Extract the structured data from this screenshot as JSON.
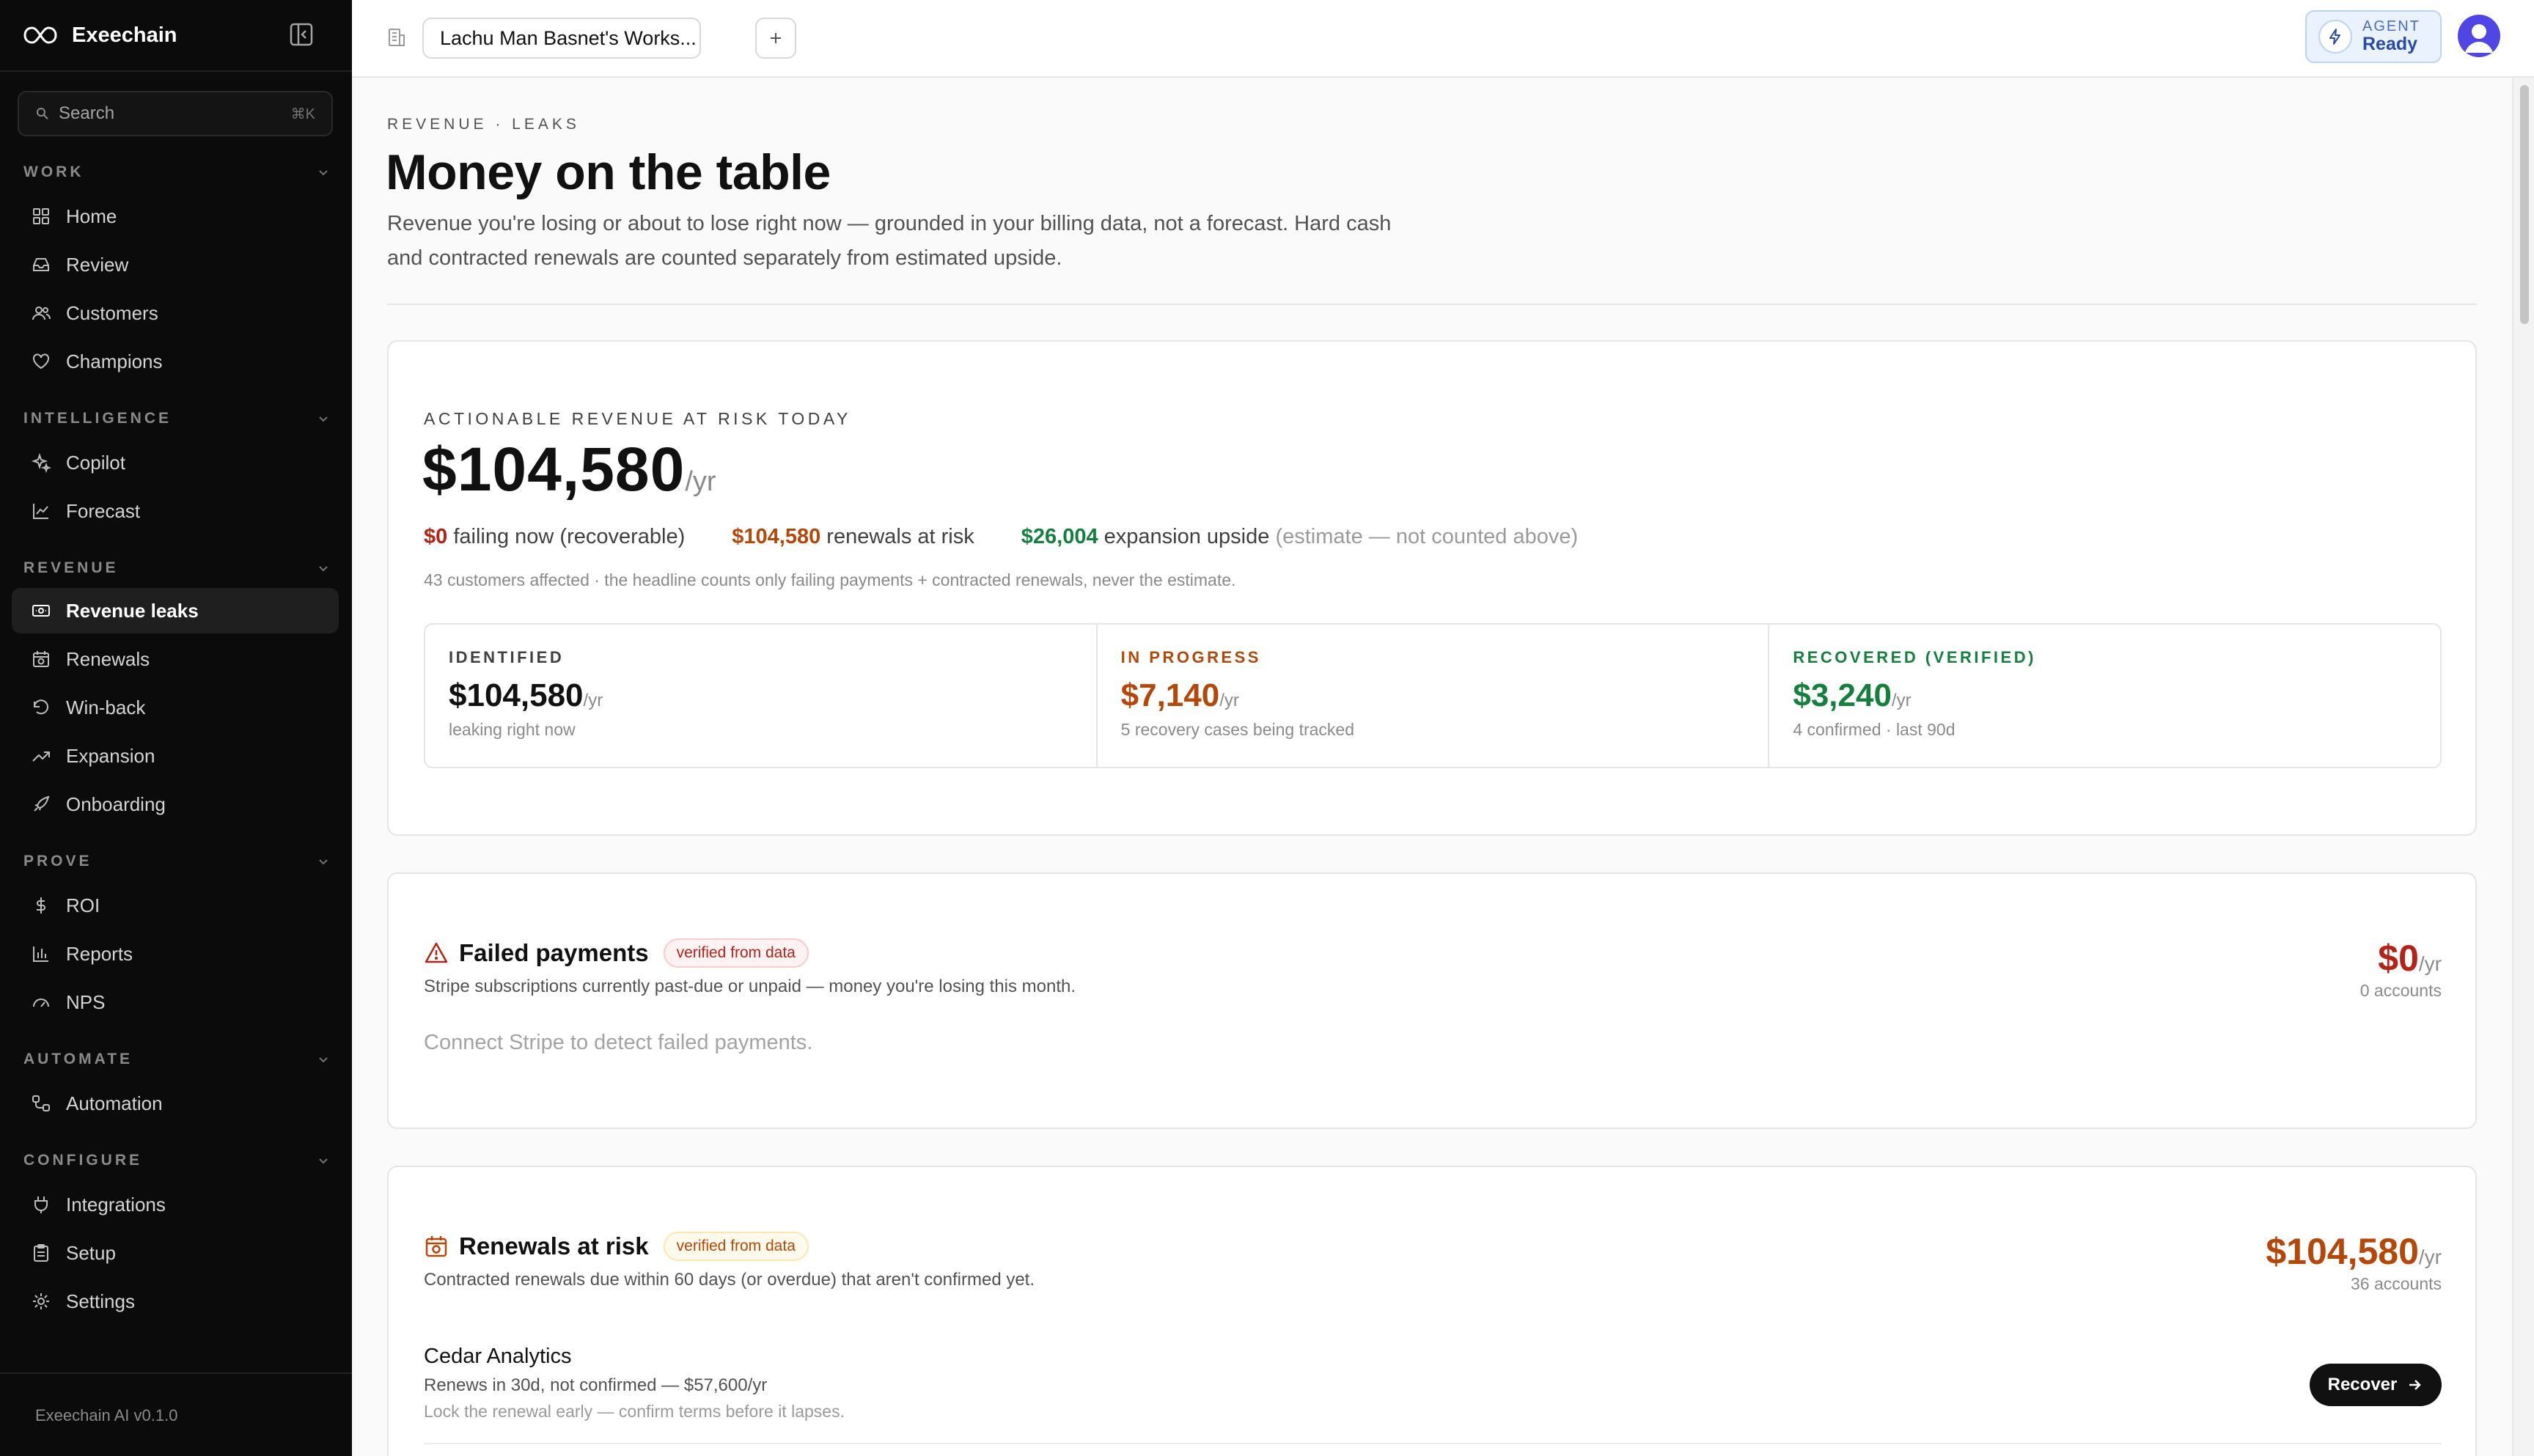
{
  "app": {
    "name": "Exeechain",
    "version": "Exeechain AI v0.1.0"
  },
  "search": {
    "label": "Search",
    "shortcut": "⌘K"
  },
  "sidebar": {
    "sections": [
      {
        "label": "WORK",
        "items": [
          {
            "label": "Home",
            "icon": "grid-icon"
          },
          {
            "label": "Review",
            "icon": "inbox-icon"
          },
          {
            "label": "Customers",
            "icon": "users-icon"
          },
          {
            "label": "Champions",
            "icon": "heart-icon"
          }
        ]
      },
      {
        "label": "INTELLIGENCE",
        "items": [
          {
            "label": "Copilot",
            "icon": "sparkles-icon"
          },
          {
            "label": "Forecast",
            "icon": "line-chart-icon"
          }
        ]
      },
      {
        "label": "REVENUE",
        "items": [
          {
            "label": "Revenue leaks",
            "icon": "banknote-icon",
            "active": true
          },
          {
            "label": "Renewals",
            "icon": "calendar-clock-icon"
          },
          {
            "label": "Win-back",
            "icon": "rotate-ccw-icon"
          },
          {
            "label": "Expansion",
            "icon": "trending-up-icon"
          },
          {
            "label": "Onboarding",
            "icon": "rocket-icon"
          }
        ]
      },
      {
        "label": "PROVE",
        "items": [
          {
            "label": "ROI",
            "icon": "dollar-icon"
          },
          {
            "label": "Reports",
            "icon": "bar-chart-icon"
          },
          {
            "label": "NPS",
            "icon": "gauge-icon"
          }
        ]
      },
      {
        "label": "AUTOMATE",
        "items": [
          {
            "label": "Automation",
            "icon": "workflow-icon"
          }
        ]
      },
      {
        "label": "CONFIGURE",
        "items": [
          {
            "label": "Integrations",
            "icon": "plug-icon"
          },
          {
            "label": "Setup",
            "icon": "clipboard-icon"
          },
          {
            "label": "Settings",
            "icon": "gear-icon"
          }
        ]
      }
    ]
  },
  "topbar": {
    "workspace": "Lachu Man Basnet's Works...",
    "agent": {
      "label": "AGENT",
      "status": "Ready"
    }
  },
  "page": {
    "eyebrow": "REVENUE · LEAKS",
    "title": "Money on the table",
    "subtitle": "Revenue you're losing or about to lose right now — grounded in your billing data, not a forecast. Hard cash and contracted renewals are counted separately from estimated upside."
  },
  "risk": {
    "label": "ACTIONABLE REVENUE AT RISK TODAY",
    "amount": "$104,580",
    "unit": "/yr",
    "failing_amount": "$0",
    "failing_text": "failing now (recoverable)",
    "renewals_amount": "$104,580",
    "renewals_text": "renewals at risk",
    "expansion_amount": "$26,004",
    "expansion_text": "expansion upside",
    "expansion_note": "(estimate — not counted above)",
    "affected": "43 customers affected · the headline counts only failing payments + contracted renewals, never the estimate.",
    "stats": [
      {
        "label": "IDENTIFIED",
        "value": "$104,580",
        "unit": "/yr",
        "note": "leaking right now"
      },
      {
        "label": "IN PROGRESS",
        "value": "$7,140",
        "unit": "/yr",
        "note": "5 recovery cases being tracked"
      },
      {
        "label": "RECOVERED (VERIFIED)",
        "value": "$3,240",
        "unit": "/yr",
        "note": "4 confirmed · last 90d"
      }
    ]
  },
  "failed": {
    "title": "Failed payments",
    "badge": "verified from data",
    "description": "Stripe subscriptions currently past-due or unpaid — money you're losing this month.",
    "amount": "$0",
    "unit": "/yr",
    "count": "0 accounts",
    "empty": "Connect Stripe to detect failed payments."
  },
  "renewals": {
    "title": "Renewals at risk",
    "badge": "verified from data",
    "description": "Contracted renewals due within 60 days (or overdue) that aren't confirmed yet.",
    "amount": "$104,580",
    "unit": "/yr",
    "count": "36 accounts",
    "rows": [
      {
        "name": "Cedar Analytics",
        "detail": "Renews in 30d, not confirmed — $57,600/yr",
        "hint": "Lock the renewal early — confirm terms before it lapses.",
        "action": "Recover"
      }
    ]
  },
  "colors": {
    "red": "#b42318",
    "orange": "#b54708",
    "green": "#15803d",
    "sidebar_bg": "#0b0b0b",
    "agent_accent": "#2a4aa8"
  }
}
